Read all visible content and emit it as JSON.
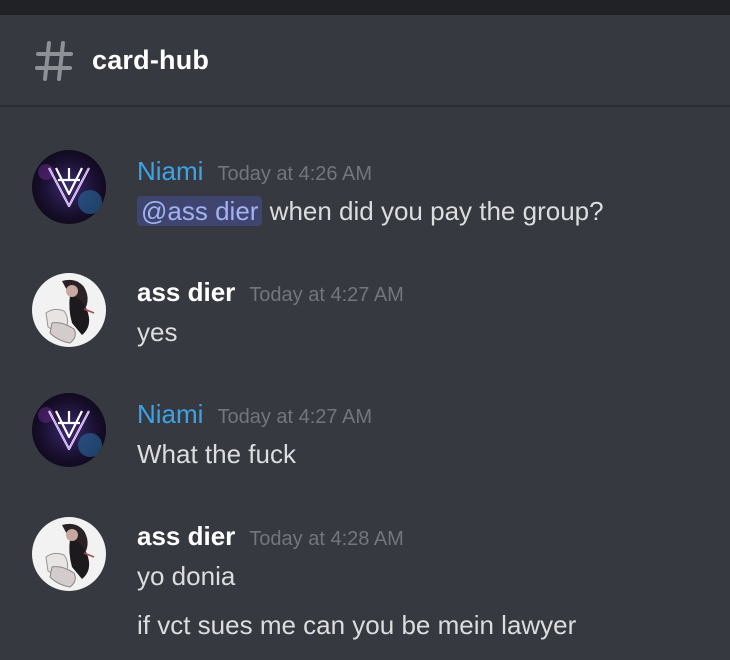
{
  "channel": {
    "name": "card-hub",
    "icon": "hash-icon"
  },
  "colors": {
    "background": "#36393f",
    "niami_name": "#3ca4e6",
    "ass_dier_name": "#ffffff",
    "timestamp": "#72767d",
    "text": "#dcddde",
    "mention_text": "#a1b3f2"
  },
  "messages": [
    {
      "author": "Niami",
      "timestamp": "Today at 4:26 AM",
      "mention": "@ass dier",
      "lines": [
        " when did you pay the group?"
      ]
    },
    {
      "author": "ass dier",
      "timestamp": "Today at 4:27 AM",
      "lines": [
        "yes"
      ]
    },
    {
      "author": "Niami",
      "timestamp": "Today at 4:27 AM",
      "lines": [
        "What the fuck"
      ]
    },
    {
      "author": "ass dier",
      "timestamp": "Today at 4:28 AM",
      "lines": [
        "yo donia",
        "if vct sues me can you be mein lawyer"
      ]
    }
  ]
}
